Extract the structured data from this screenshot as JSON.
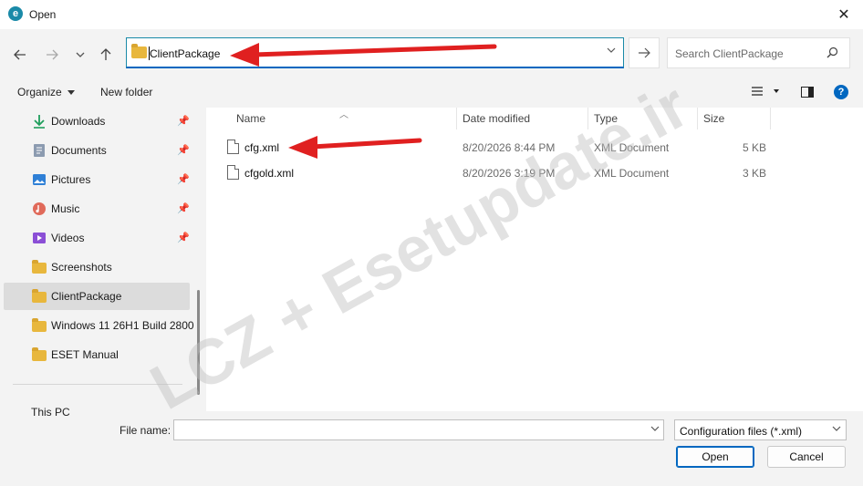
{
  "window": {
    "title": "Open",
    "app_icon_glyph": "e",
    "close_glyph": "✕"
  },
  "nav": {
    "back_icon": "arrow-left-icon",
    "forward_icon": "arrow-right-icon",
    "recent_icon": "chevron-down-icon",
    "up_icon": "arrow-up-icon",
    "address": "ClientPackage",
    "search_placeholder": "Search ClientPackage"
  },
  "toolbar": {
    "organize_label": "Organize",
    "new_folder_label": "New folder"
  },
  "sidebar": {
    "items": [
      {
        "label": "Downloads",
        "icon": "download-icon",
        "pinned": true
      },
      {
        "label": "Documents",
        "icon": "documents-icon",
        "pinned": true
      },
      {
        "label": "Pictures",
        "icon": "pictures-icon",
        "pinned": true
      },
      {
        "label": "Music",
        "icon": "music-icon",
        "pinned": true
      },
      {
        "label": "Videos",
        "icon": "videos-icon",
        "pinned": true
      },
      {
        "label": "Screenshots",
        "icon": "folder-icon",
        "pinned": false
      },
      {
        "label": "ClientPackage",
        "icon": "folder-icon",
        "pinned": false,
        "selected": true
      },
      {
        "label": "Windows 11 26H1 Build 2800",
        "icon": "folder-icon",
        "pinned": false
      },
      {
        "label": "ESET Manual",
        "icon": "folder-icon",
        "pinned": false
      }
    ],
    "partial_item": "This PC"
  },
  "filelist": {
    "columns": [
      "Name",
      "Date modified",
      "Type",
      "Size"
    ],
    "rows": [
      {
        "name": "cfg.xml",
        "date": "8/20/2026 8:44 PM",
        "type": "XML Document",
        "size": "5 KB"
      },
      {
        "name": "cfgold.xml",
        "date": "8/20/2026 3:19 PM",
        "type": "XML Document",
        "size": "3 KB"
      }
    ]
  },
  "bottom": {
    "file_name_label": "File name:",
    "file_name_value": "",
    "filter": "Configuration files (*.xml)",
    "open_label": "Open",
    "cancel_label": "Cancel"
  },
  "watermark": "LCZ + Esetupdate.ir",
  "colors": {
    "accent": "#0067c0",
    "folder": "#e8b73d",
    "arrow": "#e02020",
    "selected": "#dcdcdc"
  }
}
